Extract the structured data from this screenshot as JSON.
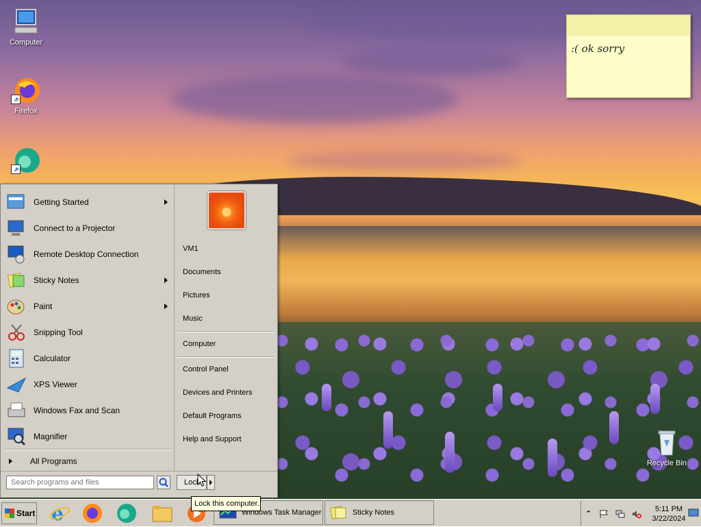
{
  "desktop": {
    "icons": [
      {
        "label": "Computer",
        "icon": "computer-icon"
      },
      {
        "label": "Firefox",
        "icon": "firefox-icon"
      },
      {
        "label": "",
        "icon": "edge-icon"
      },
      {
        "label": "Recycle Bin",
        "icon": "recycle-bin-icon"
      }
    ]
  },
  "sticky_note": {
    "text": ":( ok sorry"
  },
  "start_menu": {
    "programs": [
      {
        "label": "Getting Started",
        "icon": "getting-started-icon",
        "has_submenu": true
      },
      {
        "label": "Connect to a Projector",
        "icon": "projector-icon",
        "has_submenu": false
      },
      {
        "label": "Remote Desktop Connection",
        "icon": "remote-desktop-icon",
        "has_submenu": false
      },
      {
        "label": "Sticky Notes",
        "icon": "sticky-notes-icon",
        "has_submenu": true
      },
      {
        "label": "Paint",
        "icon": "paint-icon",
        "has_submenu": true
      },
      {
        "label": "Snipping Tool",
        "icon": "snipping-tool-icon",
        "has_submenu": false
      },
      {
        "label": "Calculator",
        "icon": "calculator-icon",
        "has_submenu": false
      },
      {
        "label": "XPS Viewer",
        "icon": "xps-viewer-icon",
        "has_submenu": false
      },
      {
        "label": "Windows Fax and Scan",
        "icon": "fax-icon",
        "has_submenu": false
      },
      {
        "label": "Magnifier",
        "icon": "magnifier-icon",
        "has_submenu": false
      }
    ],
    "all_programs": "All Programs",
    "right": {
      "user": "VM1",
      "items": [
        "Documents",
        "Pictures",
        "Music",
        "Computer",
        "Control Panel",
        "Devices and Printers",
        "Default Programs",
        "Help and Support"
      ]
    },
    "search_placeholder": "Search programs and files",
    "lock_label": "Lock"
  },
  "tooltip": "Lock this computer.",
  "taskbar": {
    "start_label": "Start",
    "quick_launch": [
      "ie-icon",
      "firefox-icon",
      "edge-icon",
      "explorer-icon",
      "media-icon"
    ],
    "tasks": [
      {
        "label": "Windows Task Manager",
        "icon": "task-manager-icon"
      },
      {
        "label": "Sticky Notes",
        "icon": "sticky-notes-icon"
      }
    ],
    "clock": {
      "time": "5:11 PM",
      "date": "3/22/2024"
    }
  }
}
